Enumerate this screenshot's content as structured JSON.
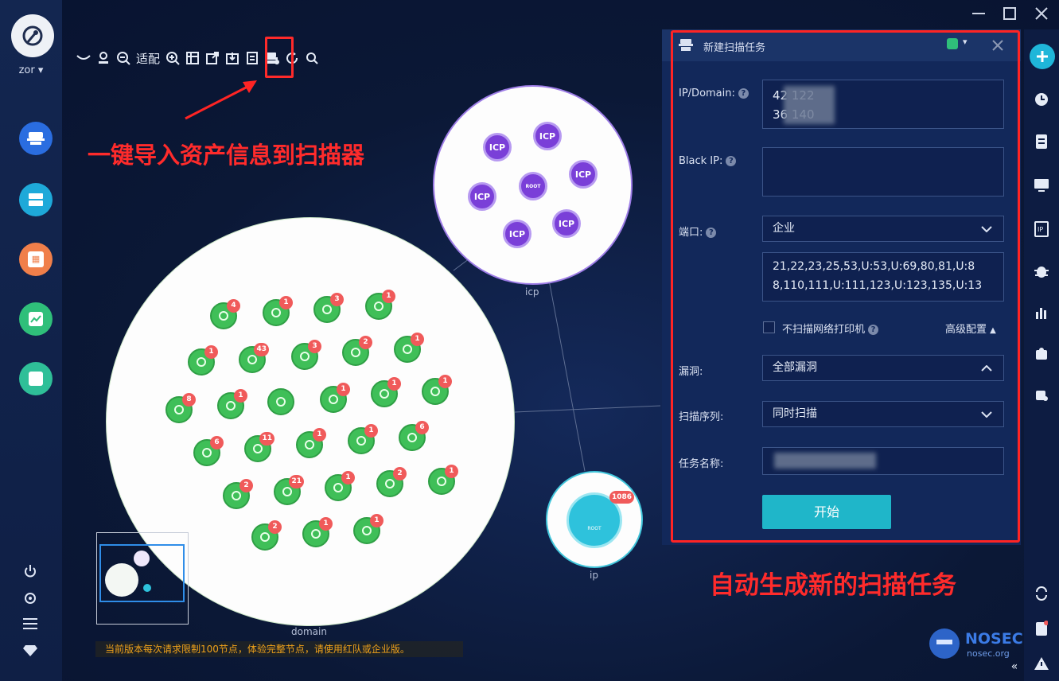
{
  "user": {
    "name": "zor"
  },
  "toolbar": {
    "fit_label": "适配"
  },
  "annotations": {
    "import_hint": "一键导入资产信息到扫描器",
    "auto_hint": "自动生成新的扫描任务"
  },
  "graph": {
    "domain_label": "domain",
    "icp_label": "icp",
    "ip_label": "ip",
    "root_label": "ROOT",
    "icp_node_label": "ICP",
    "ip_badge": "1086",
    "domain_badges": [
      "4",
      "1",
      "3",
      "1",
      "1",
      "43",
      "3",
      "2",
      "1",
      "8",
      "1",
      "1",
      "1",
      "1",
      "6",
      "11",
      "1",
      "1",
      "6",
      "2",
      "21",
      "1",
      "2",
      "1",
      "2",
      "1",
      "1"
    ]
  },
  "notice": "当前版本每次请求限制100节点，体验完整节点，请使用红队或企业版。",
  "panel": {
    "title": "新建扫描任务",
    "ip_label": "IP/Domain:",
    "ip_value_line1": "42          122",
    "ip_value_line2": "36          140",
    "black_ip_label": "Black IP:",
    "port_label": "端口:",
    "port_select": "企业",
    "port_list_line1": "21,22,23,25,53,U:53,U:69,80,81,U:8",
    "port_list_line2": "8,110,111,U:111,123,U:123,135,U:13",
    "no_printer_label": "不扫描网络打印机",
    "advanced_label": "高级配置",
    "vuln_label": "漏洞:",
    "vuln_select": "全部漏洞",
    "order_label": "扫描序列:",
    "order_select": "同时扫描",
    "task_label": "任务名称:",
    "start_label": "开始"
  },
  "brand": {
    "name": "NOSEC",
    "site": "nosec.org"
  },
  "colors": {
    "accent": "#1fb6c9",
    "annotation": "#ff2424",
    "node_green": "#3fbf58",
    "icp_purple": "#7a3fd8"
  }
}
